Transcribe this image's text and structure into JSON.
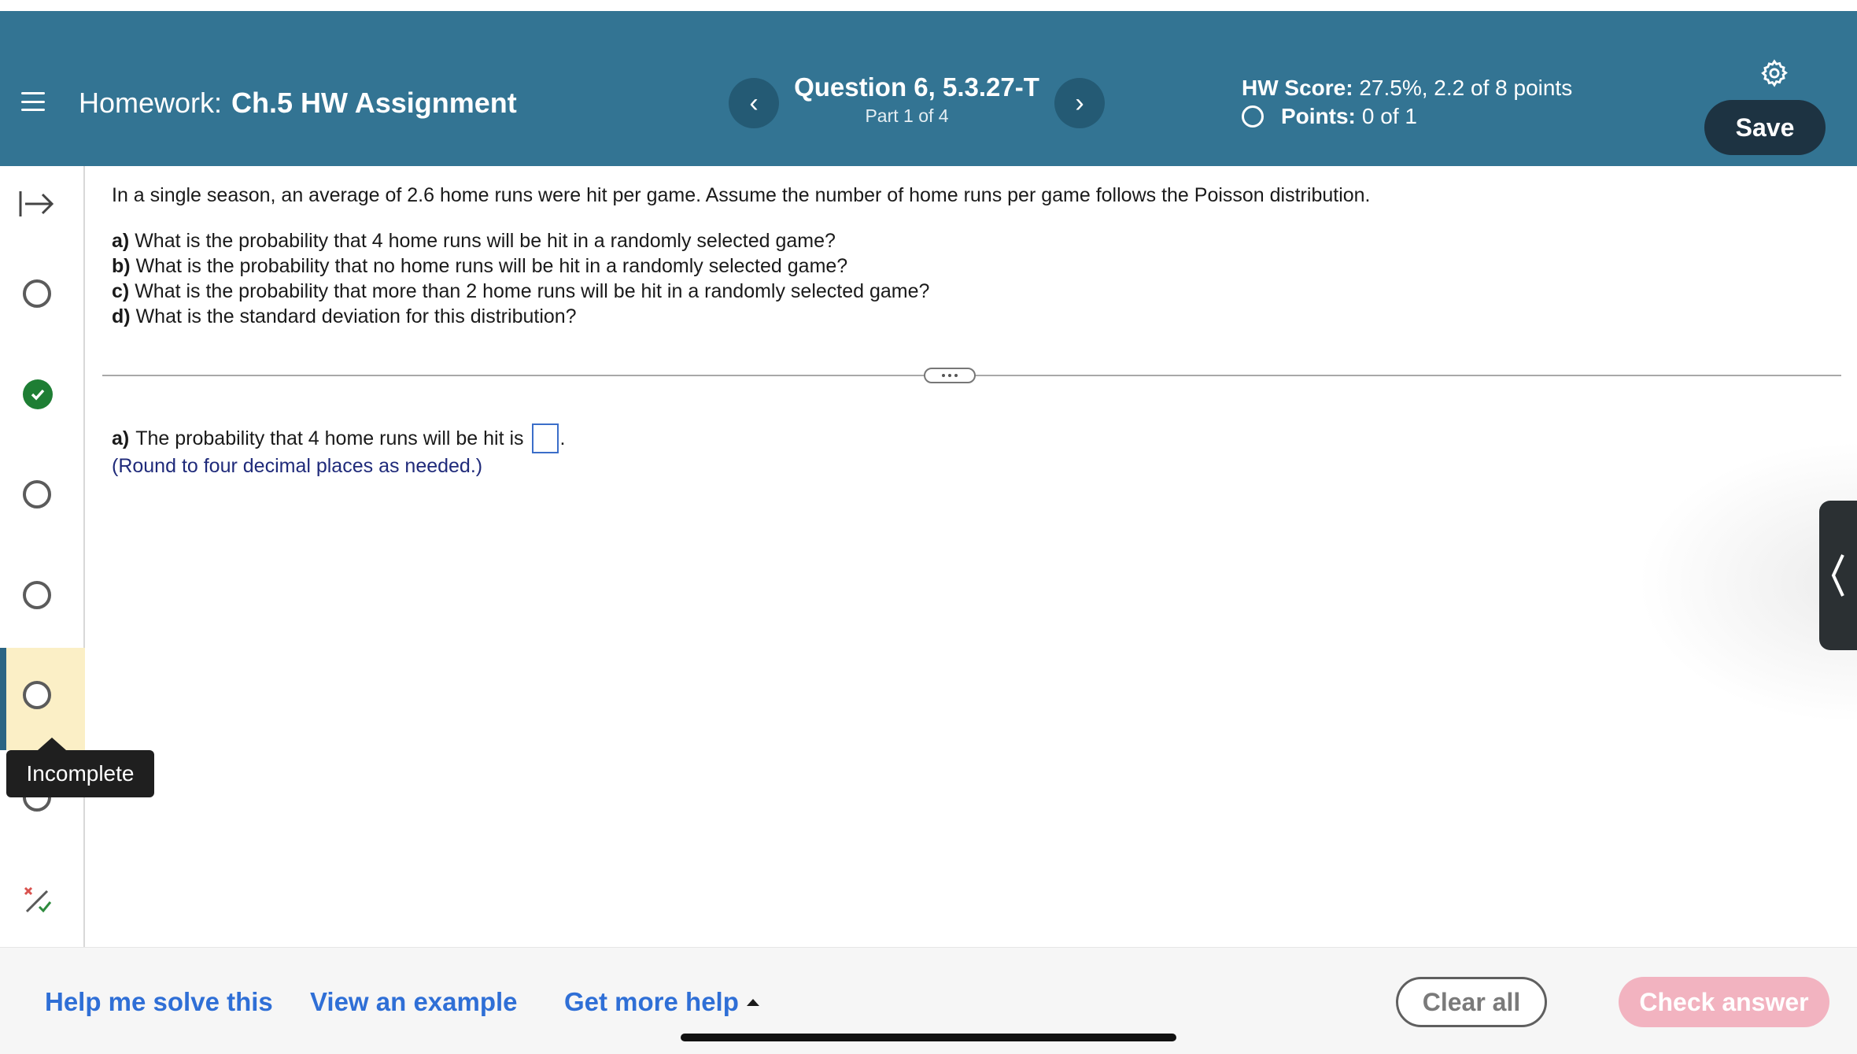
{
  "header": {
    "hw_label": "Homework:",
    "hw_name": "Ch.5 HW Assignment",
    "question_title": "Question 6, 5.3.27-T",
    "question_part": "Part 1 of 4",
    "prev_label": "‹",
    "next_label": "›",
    "score_label": "HW Score:",
    "score_value": "27.5%, 2.2 of 8 points",
    "points_label": "Points:",
    "points_value": "0 of 1",
    "save_label": "Save",
    "accent_color": "#337493"
  },
  "rail": {
    "tooltip": "Incomplete",
    "statuses": [
      "incomplete",
      "complete",
      "incomplete",
      "incomplete",
      "incomplete-current",
      "incomplete"
    ]
  },
  "question": {
    "intro": "In a single season, an average of 2.6 home runs were hit per game. Assume the number of home runs per game follows the Poisson distribution.",
    "parts": [
      {
        "label": "a)",
        "text": "What is the probability that 4 home runs will be hit in a randomly selected game?"
      },
      {
        "label": "b)",
        "text": "What is the probability that no home runs will be hit in a randomly selected game?"
      },
      {
        "label": "c)",
        "text": "What is the probability that more than 2 home runs will be hit in a randomly selected game?"
      },
      {
        "label": "d)",
        "text": "What is the standard deviation for this distribution?"
      }
    ]
  },
  "answer": {
    "label": "a)",
    "text": "The probability that 4 home runs will be hit is",
    "value": "",
    "after": ".",
    "hint": "(Round to four decimal places as needed.)"
  },
  "footer": {
    "help_label": "Help me solve this",
    "example_label": "View an example",
    "more_label": "Get more help",
    "clear_label": "Clear all",
    "check_label": "Check answer"
  }
}
